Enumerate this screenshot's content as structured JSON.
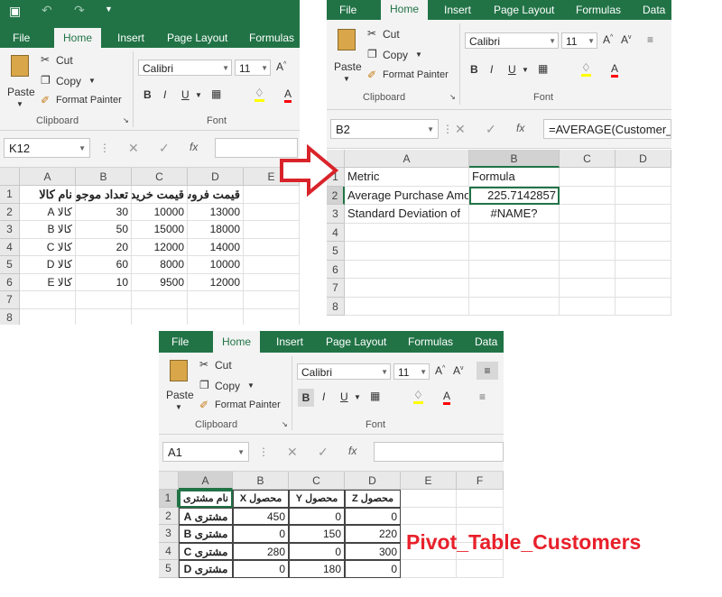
{
  "w1": {
    "qat": {
      "save_icon": "save-icon",
      "undo_icon": "undo-icon",
      "redo_icon": "redo-icon"
    },
    "tabs": [
      "File",
      "Home",
      "Insert",
      "Page Layout",
      "Formulas"
    ],
    "clipboard": {
      "paste": "Paste",
      "cut": "Cut",
      "copy": "Copy",
      "format_painter": "Format Painter",
      "group": "Clipboard"
    },
    "font": {
      "name": "Calibri",
      "size": "11",
      "group": "Font"
    },
    "namebox": "K12",
    "columns": [
      "A",
      "B",
      "C",
      "D",
      "E"
    ],
    "rows": [
      "1",
      "2",
      "3",
      "4",
      "5",
      "6",
      "7",
      "8"
    ],
    "header": [
      "نام کالا",
      "تعداد موجودی",
      "قیمت خرید",
      "قیمت فروش"
    ],
    "data": [
      [
        "کالا A",
        "30",
        "10000",
        "13000"
      ],
      [
        "کالا B",
        "50",
        "15000",
        "18000"
      ],
      [
        "کالا C",
        "20",
        "12000",
        "14000"
      ],
      [
        "کالا D",
        "60",
        "8000",
        "10000"
      ],
      [
        "کالا E",
        "10",
        "9500",
        "12000"
      ]
    ]
  },
  "w2": {
    "tabs": [
      "File",
      "Home",
      "Insert",
      "Page Layout",
      "Formulas",
      "Data"
    ],
    "clipboard": {
      "paste": "Paste",
      "cut": "Cut",
      "copy": "Copy",
      "format_painter": "Format Painter",
      "group": "Clipboard"
    },
    "font": {
      "name": "Calibri",
      "size": "11",
      "group": "Font"
    },
    "namebox": "B2",
    "formula": "=AVERAGE(Customer_",
    "columns": [
      "A",
      "B",
      "C",
      "D"
    ],
    "rows": [
      "1",
      "2",
      "3",
      "4",
      "5",
      "6",
      "7",
      "8"
    ],
    "cells": [
      [
        "Metric",
        "Formula"
      ],
      [
        "Average Purchase Amo",
        "225.7142857"
      ],
      [
        "Standard Deviation of",
        "#NAME?"
      ]
    ]
  },
  "w3": {
    "tabs": [
      "File",
      "Home",
      "Insert",
      "Page Layout",
      "Formulas",
      "Data"
    ],
    "clipboard": {
      "paste": "Paste",
      "cut": "Cut",
      "copy": "Copy",
      "format_painter": "Format Painter",
      "group": "Clipboard"
    },
    "font": {
      "name": "Calibri",
      "size": "11",
      "group": "Font"
    },
    "namebox": "A1",
    "columns": [
      "A",
      "B",
      "C",
      "D",
      "E",
      "F"
    ],
    "rows": [
      "1",
      "2",
      "3",
      "4",
      "5"
    ],
    "header": [
      "نام مشتری",
      "محصول X",
      "محصول Y",
      "محصول Z"
    ],
    "data": [
      [
        "مشتری A",
        "450",
        "0",
        "0"
      ],
      [
        "مشتری B",
        "0",
        "150",
        "220"
      ],
      [
        "مشتری C",
        "280",
        "0",
        "300"
      ],
      [
        "مشتری D",
        "0",
        "180",
        "0"
      ]
    ]
  },
  "caption": "Pivot_Table_Customers",
  "colors": {
    "excel_green": "#217346",
    "arrow_red": "#d9232a",
    "caption_red": "#e8202a"
  }
}
